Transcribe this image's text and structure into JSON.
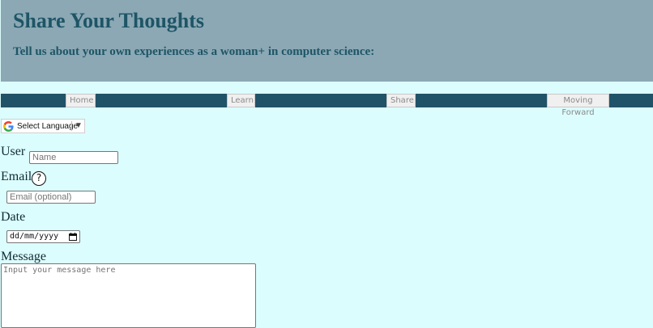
{
  "header": {
    "title": "Share Your Thoughts",
    "subtitle": "Tell us about your own experiences as a woman+ in computer science:"
  },
  "nav": {
    "items": [
      {
        "label": "Home"
      },
      {
        "label": "Learn"
      },
      {
        "label": "Share"
      },
      {
        "label": "Moving Forward"
      }
    ]
  },
  "translate": {
    "label": "Select Language",
    "caret": "▼",
    "icon": "google-g-icon"
  },
  "form": {
    "user_label": "User",
    "user_placeholder": "Name",
    "email_label": "Email",
    "email_help": "?",
    "email_placeholder": "Email (optional)",
    "date_label": "Date",
    "date_value": "dd/mm/yyyy",
    "message_label": "Message",
    "message_placeholder": "Input your message here"
  },
  "colors": {
    "page_bg": "#dcfdfd",
    "header_bg": "#8ba8b4",
    "header_text": "#1e5566",
    "nav_bg": "#215368"
  }
}
